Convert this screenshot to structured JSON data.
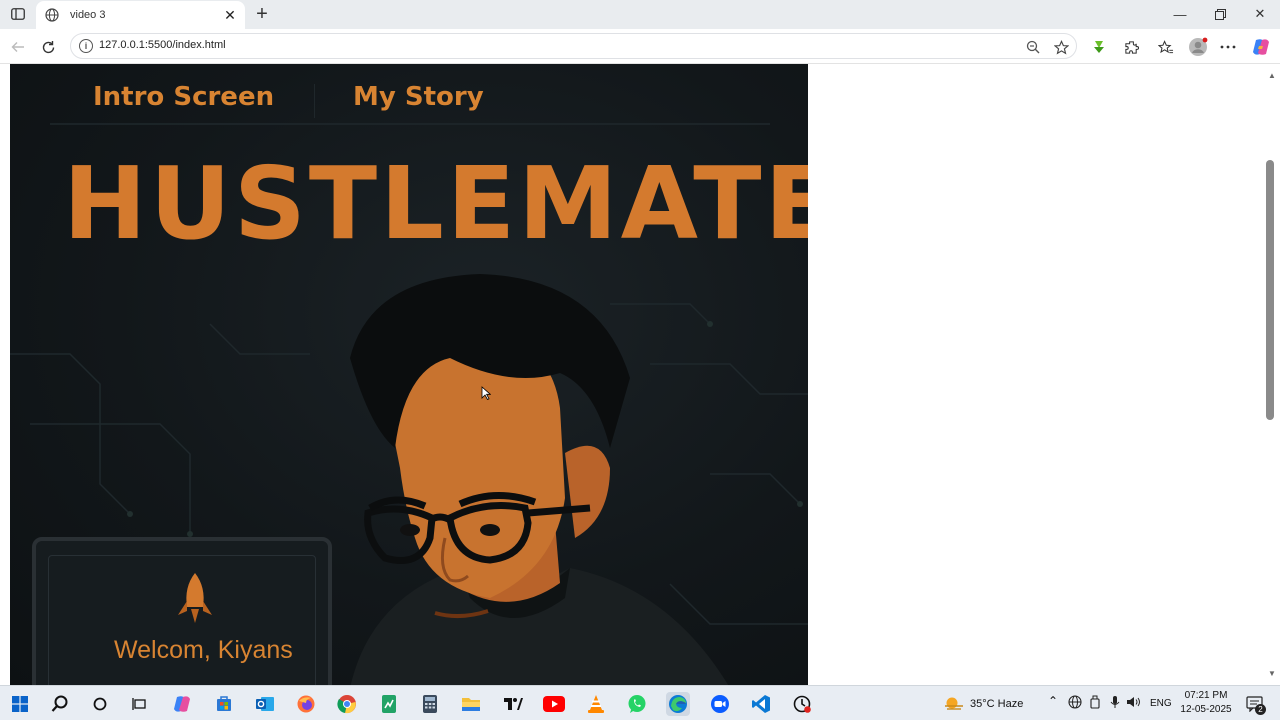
{
  "browser": {
    "tab_title": "video 3",
    "url": "127.0.0.1:5500/index.html"
  },
  "page": {
    "nav": {
      "intro": "Intro Screen",
      "story": "My Story"
    },
    "brand": "HUSTLEMATE",
    "welcome": "Welcom, Kiyans"
  },
  "taskbar": {
    "weather": "35°C  Haze",
    "language": "ENG",
    "time": "07:21 PM",
    "date": "12-05-2025",
    "notifications": "2"
  },
  "colors": {
    "accent": "#d47a2e",
    "hero_bg": "#12171a",
    "browser_chrome": "#e9ecef"
  }
}
